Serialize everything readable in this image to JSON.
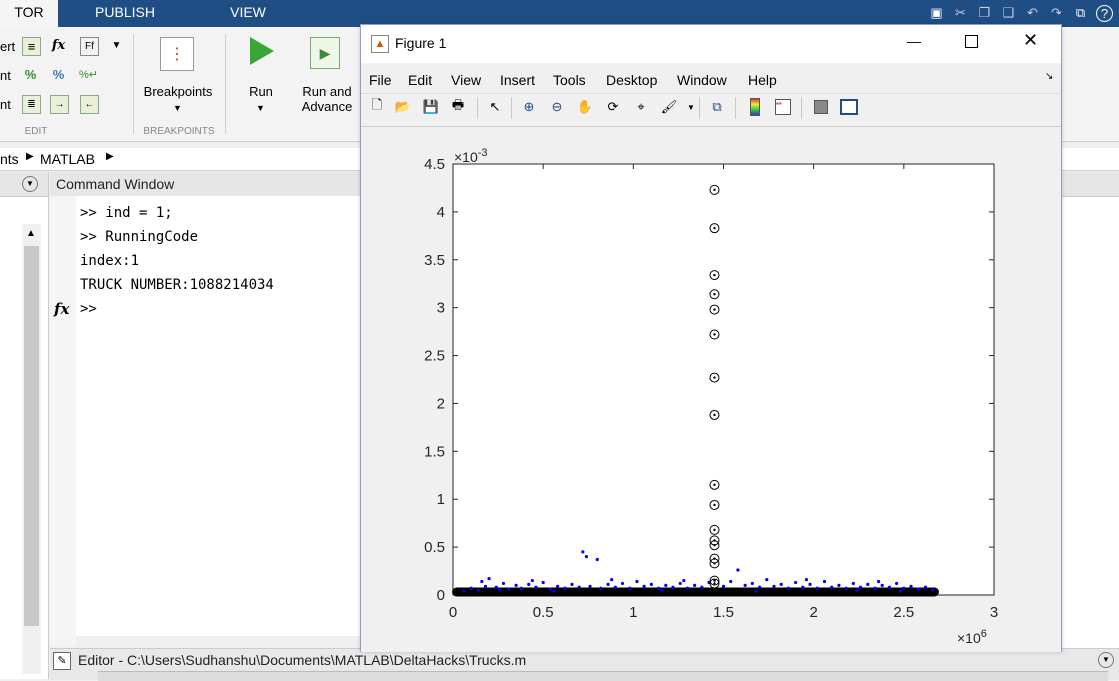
{
  "toolstrip": {
    "tabs": [
      {
        "label": "TOR"
      },
      {
        "label": "PUBLISH"
      },
      {
        "label": "VIEW"
      }
    ],
    "partial_labels": [
      "ert",
      "nt",
      "nt"
    ],
    "breakpoints_label": "Breakpoints",
    "run_label": "Run",
    "run_advance_label_1": "Run and",
    "run_advance_label_2": "Advance",
    "section_edit": "EDIT",
    "section_breakpoints": "BREAKPOINTS"
  },
  "address": {
    "crumb1": "nts",
    "crumb2": "MATLAB"
  },
  "command_window": {
    "title": "Command Window",
    "lines": [
      ">> ind = 1;",
      ">> RunningCode",
      "index:1",
      "TRUCK NUMBER:1088214034",
      ">>"
    ],
    "fx": "fx"
  },
  "figure": {
    "title": "Figure 1",
    "menu": [
      "File",
      "Edit",
      "View",
      "Insert",
      "Tools",
      "Desktop",
      "Window",
      "Help"
    ]
  },
  "editor_bar": {
    "label": "Editor - C:\\Users\\Sudhanshu\\Documents\\MATLAB\\DeltaHacks\\Trucks.m"
  },
  "chart_data": {
    "type": "scatter",
    "title": "",
    "xlabel": "",
    "ylabel": "",
    "xlim": [
      0,
      3
    ],
    "ylim": [
      0,
      4.5
    ],
    "x_multiplier": "×10^6",
    "y_multiplier": "×10^-3",
    "x_ticks": [
      0,
      0.5,
      1,
      1.5,
      2,
      2.5,
      3
    ],
    "x_tick_labels": [
      "0",
      "0.5",
      "1",
      "1.5",
      "2",
      "2.5",
      "3"
    ],
    "y_ticks": [
      0,
      0.5,
      1,
      1.5,
      2,
      2.5,
      3,
      3.5,
      4,
      4.5
    ],
    "y_tick_labels": [
      "0",
      "0.5",
      "1",
      "1.5",
      "2",
      "2.5",
      "3",
      "3.5",
      "4",
      "4.5"
    ],
    "circle_x": 1.45,
    "circle_y": [
      4.23,
      3.83,
      3.34,
      3.14,
      2.98,
      2.72,
      2.27,
      1.88,
      1.15,
      0.94,
      0.68,
      0.57,
      0.52,
      0.38,
      0.33,
      0.15,
      0.12
    ],
    "baseline_x": [
      0.02,
      2.67
    ],
    "baseline_y": 0,
    "dots": [
      [
        0.06,
        0.02
      ],
      [
        0.1,
        0.05
      ],
      [
        0.14,
        0.03
      ],
      [
        0.18,
        0.07
      ],
      [
        0.2,
        0.15
      ],
      [
        0.24,
        0.06
      ],
      [
        0.28,
        0.1
      ],
      [
        0.31,
        0.04
      ],
      [
        0.35,
        0.08
      ],
      [
        0.38,
        0.05
      ],
      [
        0.42,
        0.09
      ],
      [
        0.46,
        0.06
      ],
      [
        0.5,
        0.11
      ],
      [
        0.54,
        0.04
      ],
      [
        0.58,
        0.07
      ],
      [
        0.62,
        0.05
      ],
      [
        0.66,
        0.09
      ],
      [
        0.7,
        0.06
      ],
      [
        0.72,
        0.43
      ],
      [
        0.74,
        0.38
      ],
      [
        0.76,
        0.07
      ],
      [
        0.8,
        0.35
      ],
      [
        0.82,
        0.05
      ],
      [
        0.86,
        0.09
      ],
      [
        0.9,
        0.06
      ],
      [
        0.94,
        0.1
      ],
      [
        0.98,
        0.05
      ],
      [
        1.02,
        0.12
      ],
      [
        1.06,
        0.07
      ],
      [
        1.1,
        0.09
      ],
      [
        1.14,
        0.05
      ],
      [
        1.18,
        0.08
      ],
      [
        1.22,
        0.06
      ],
      [
        1.26,
        0.1
      ],
      [
        1.3,
        0.05
      ],
      [
        1.34,
        0.08
      ],
      [
        1.38,
        0.06
      ],
      [
        1.42,
        0.11
      ],
      [
        1.5,
        0.07
      ],
      [
        1.54,
        0.12
      ],
      [
        1.58,
        0.24
      ],
      [
        1.62,
        0.08
      ],
      [
        1.66,
        0.1
      ],
      [
        1.7,
        0.06
      ],
      [
        1.74,
        0.14
      ],
      [
        1.78,
        0.07
      ],
      [
        1.82,
        0.09
      ],
      [
        1.86,
        0.05
      ],
      [
        1.9,
        0.11
      ],
      [
        1.94,
        0.06
      ],
      [
        1.98,
        0.09
      ],
      [
        2.02,
        0.05
      ],
      [
        2.06,
        0.12
      ],
      [
        2.1,
        0.06
      ],
      [
        2.14,
        0.08
      ],
      [
        2.18,
        0.05
      ],
      [
        2.22,
        0.1
      ],
      [
        2.26,
        0.06
      ],
      [
        2.3,
        0.09
      ],
      [
        2.34,
        0.05
      ],
      [
        2.38,
        0.08
      ],
      [
        2.42,
        0.06
      ],
      [
        2.46,
        0.1
      ],
      [
        2.5,
        0.05
      ],
      [
        2.54,
        0.07
      ],
      [
        2.58,
        0.04
      ],
      [
        2.62,
        0.06
      ],
      [
        2.66,
        0.03
      ],
      [
        0.16,
        0.12
      ],
      [
        0.44,
        0.13
      ],
      [
        0.88,
        0.14
      ],
      [
        1.28,
        0.13
      ],
      [
        1.96,
        0.14
      ],
      [
        2.36,
        0.12
      ],
      [
        0.26,
        0.03
      ],
      [
        0.56,
        0.02
      ],
      [
        1.16,
        0.03
      ],
      [
        1.68,
        0.02
      ],
      [
        2.24,
        0.03
      ],
      [
        2.48,
        0.02
      ]
    ],
    "colors": {
      "dot": "#0000ff",
      "circle": "#000000"
    }
  }
}
